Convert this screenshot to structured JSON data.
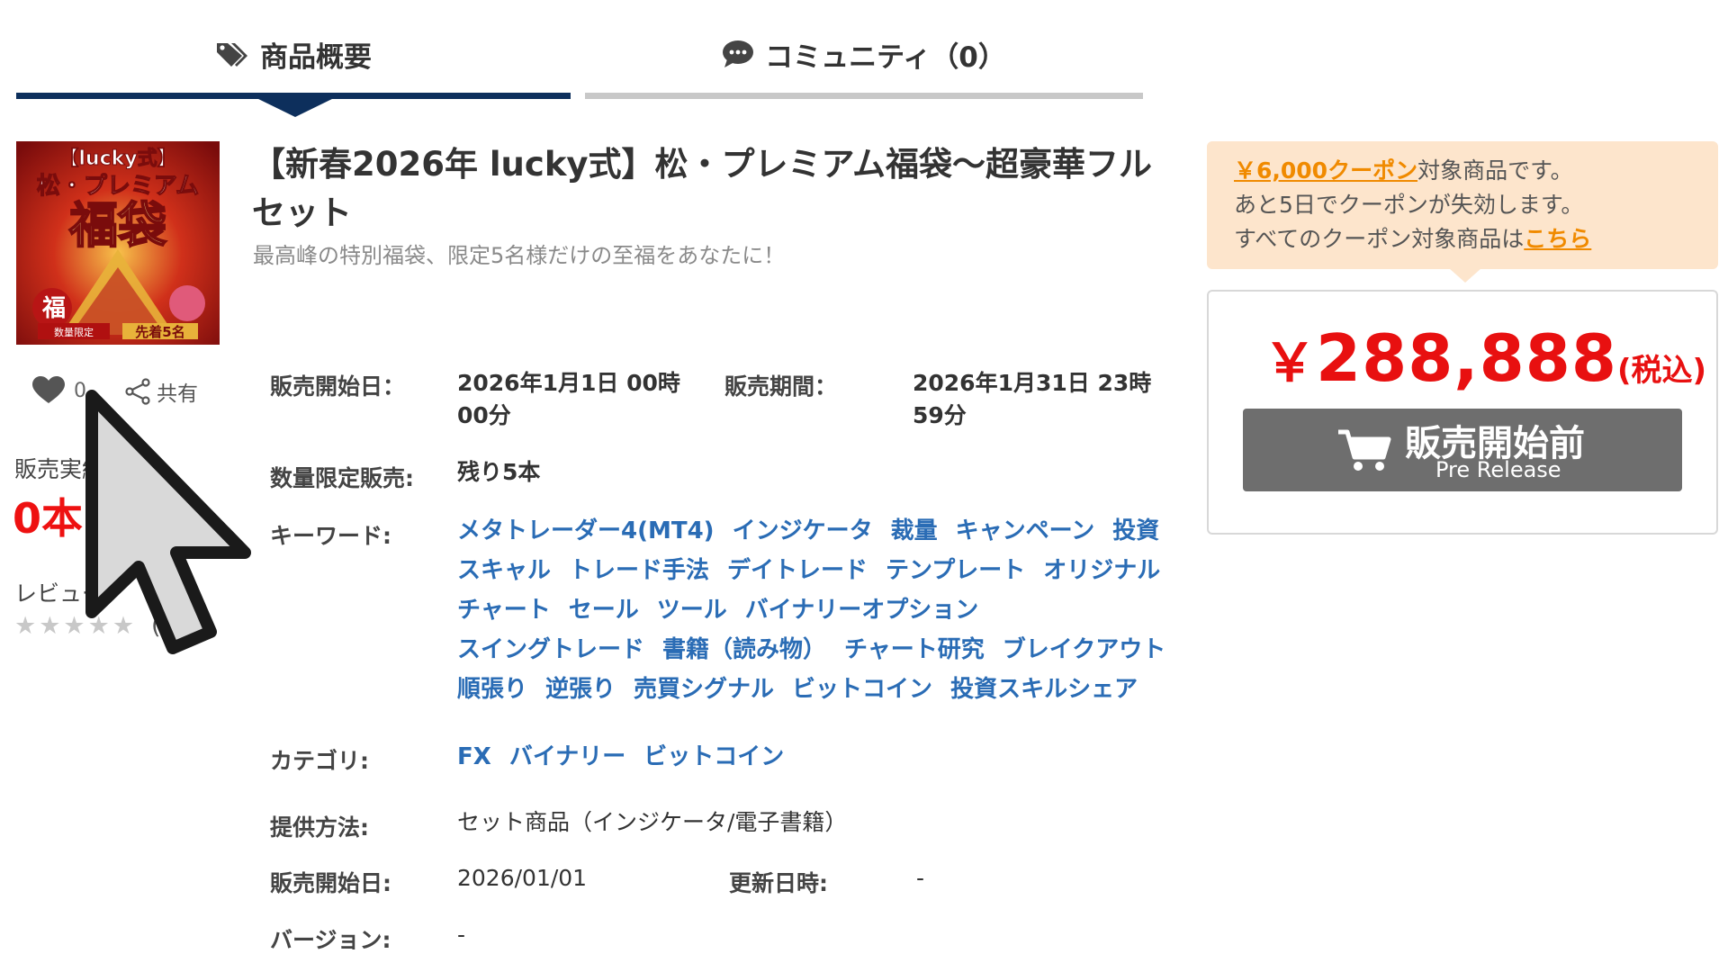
{
  "tabs": [
    {
      "label": "商品概要",
      "active": true,
      "icon": "tag-icon"
    },
    {
      "label": "コミュニティ（0）",
      "active": false,
      "icon": "chat-bubble-icon"
    }
  ],
  "product": {
    "title": "【新春2026年 lucky式】松・プレミアム福袋～超豪華フルセット",
    "subtitle": "最高峰の特別福袋、限定5名様だけの至福をあなたに！",
    "image_text": {
      "line1": "【lucky式】",
      "line2": "松・プレミアム",
      "line3": "福袋",
      "badge_left": "数量限定",
      "badge_right": "先着5名",
      "fuku": "福"
    }
  },
  "left": {
    "like_count": "0",
    "share_label": "共有",
    "sales_label": "販売実績",
    "sales_count": "0本",
    "review_label": "レビュー",
    "stars": "★★★★★",
    "stars_paren": "("
  },
  "details": {
    "sale_start_label": "販売開始日：",
    "sale_start_value": "2026年1月1日 00時00分",
    "sale_period_label": "販売期間：",
    "sale_period_value": "2026年1月31日 23時59分",
    "limited_label": "数量限定販売:",
    "limited_value": "残り5本",
    "keyword_label": "キーワード:",
    "keywords": [
      "メタトレーダー4(MT4)",
      "インジケータ",
      "裁量",
      "キャンペーン",
      "投資",
      "スキャル",
      "トレード手法",
      "デイトレード",
      "テンプレート",
      "オリジナル",
      "チャート",
      "セール",
      "ツール",
      "バイナリーオプション",
      "スイングトレード",
      "書籍（読み物）",
      "チャート研究",
      "ブレイクアウト",
      "順張り",
      "逆張り",
      "売買シグナル",
      "ビットコイン",
      "投資スキルシェア"
    ],
    "category_label": "カテゴリ:",
    "categories": [
      "FX",
      "バイナリー",
      "ビットコイン"
    ],
    "delivery_label": "提供方法:",
    "delivery_value": "セット商品（インジケータ/電子書籍）",
    "start_date_label": "販売開始日:",
    "start_date_value": "2026/01/01",
    "updated_label": "更新日時:",
    "updated_value": "-",
    "version_label": "バージョン:",
    "version_value": "-"
  },
  "coupon": {
    "amount_link": "￥6,000クーポン",
    "line1_rest": "対象商品です。",
    "line2": "あと5日でクーポンが失効します。",
    "line3_prefix": "すべてのクーポン対象商品は",
    "line3_link": "こちら"
  },
  "price": {
    "yen": "￥",
    "amount": "288,888",
    "tax": "(税込)"
  },
  "button": {
    "main": "販売開始前",
    "sub": "Pre Release",
    "icon": "cart-icon"
  },
  "colors": {
    "tab_active": "#0d2f5c",
    "tab_inactive": "#c8c8c8",
    "link": "#2a6cb5",
    "price": "#e81010",
    "coupon_bg": "#fde5cc",
    "coupon_link": "#f08a00",
    "button_bg": "#6e6e6e"
  }
}
